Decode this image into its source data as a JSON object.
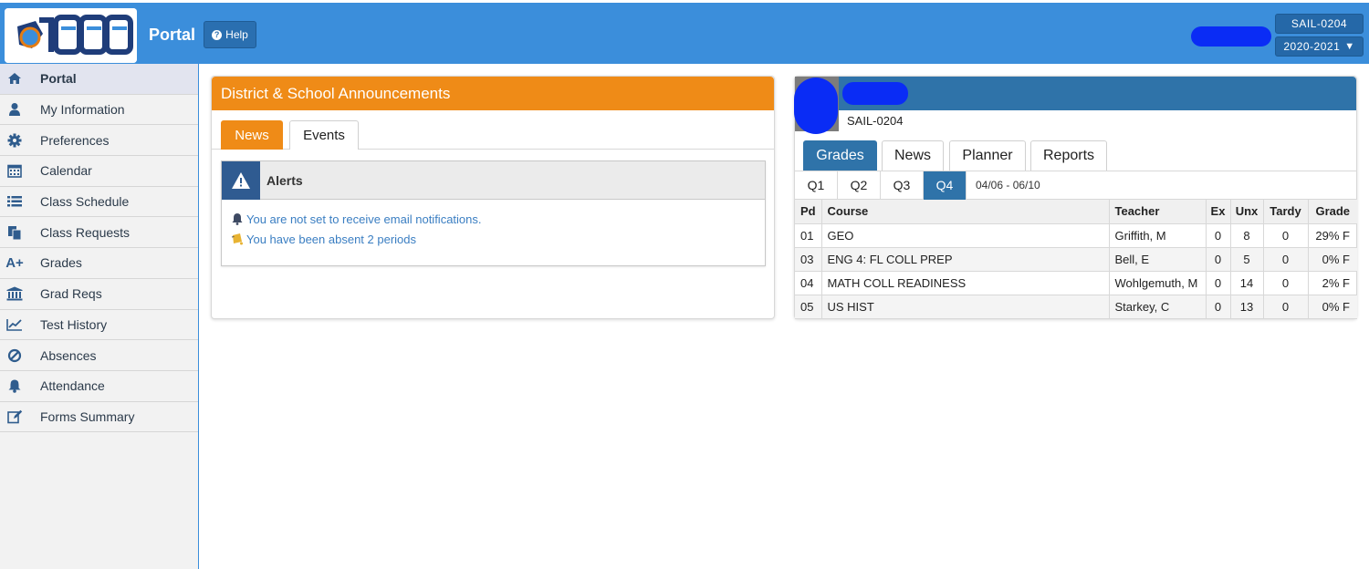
{
  "header": {
    "app_title": "Portal",
    "help_label": "Help",
    "school_code": "SAIL-0204",
    "school_year": "2020-2021",
    "year_caret": "▼"
  },
  "sidebar": {
    "items": [
      {
        "label": "Portal",
        "icon": "home-icon"
      },
      {
        "label": "My Information",
        "icon": "user-icon"
      },
      {
        "label": "Preferences",
        "icon": "gear-icon"
      },
      {
        "label": "Calendar",
        "icon": "calendar-icon"
      },
      {
        "label": "Class Schedule",
        "icon": "list-icon"
      },
      {
        "label": "Class Requests",
        "icon": "document-icon"
      },
      {
        "label": "Grades",
        "icon": "a-plus-icon"
      },
      {
        "label": "Grad Reqs",
        "icon": "institution-icon"
      },
      {
        "label": "Test History",
        "icon": "line-chart-icon"
      },
      {
        "label": "Absences",
        "icon": "ban-icon"
      },
      {
        "label": "Attendance",
        "icon": "bell-icon"
      },
      {
        "label": "Forms Summary",
        "icon": "edit-icon"
      }
    ]
  },
  "announcements": {
    "title": "District & School Announcements",
    "tabs": [
      "News",
      "Events"
    ],
    "alerts_title": "Alerts",
    "alerts": [
      "You are not set to receive email notifications.",
      "You have been absent 2 periods"
    ]
  },
  "student": {
    "school_code": "SAIL-0204",
    "tabs": [
      "Grades",
      "News",
      "Planner",
      "Reports"
    ],
    "quarters": [
      "Q1",
      "Q2",
      "Q3",
      "Q4"
    ],
    "active_quarter": "Q4",
    "date_range": "04/06 - 06/10",
    "table": {
      "headers": [
        "Pd",
        "Course",
        "Teacher",
        "Ex",
        "Unx",
        "Tardy",
        "Grade"
      ],
      "rows": [
        {
          "pd": "01",
          "course": "GEO",
          "teacher": "Griffith, M",
          "ex": "0",
          "unx": "8",
          "tardy": "0",
          "grade": "29% F"
        },
        {
          "pd": "03",
          "course": "ENG 4: FL COLL PREP",
          "teacher": "Bell, E",
          "ex": "0",
          "unx": "5",
          "tardy": "0",
          "grade": "0% F"
        },
        {
          "pd": "04",
          "course": "MATH COLL READINESS",
          "teacher": "Wohlgemuth, M",
          "ex": "0",
          "unx": "14",
          "tardy": "0",
          "grade": "2% F"
        },
        {
          "pd": "05",
          "course": "US HIST",
          "teacher": "Starkey, C",
          "ex": "0",
          "unx": "13",
          "tardy": "0",
          "grade": "0% F"
        }
      ]
    }
  },
  "colors": {
    "header_blue": "#3b8edb",
    "panel_orange": "#ef8b17",
    "panel_dark_blue": "#2f73a9",
    "link_blue": "#3a7ec2"
  }
}
